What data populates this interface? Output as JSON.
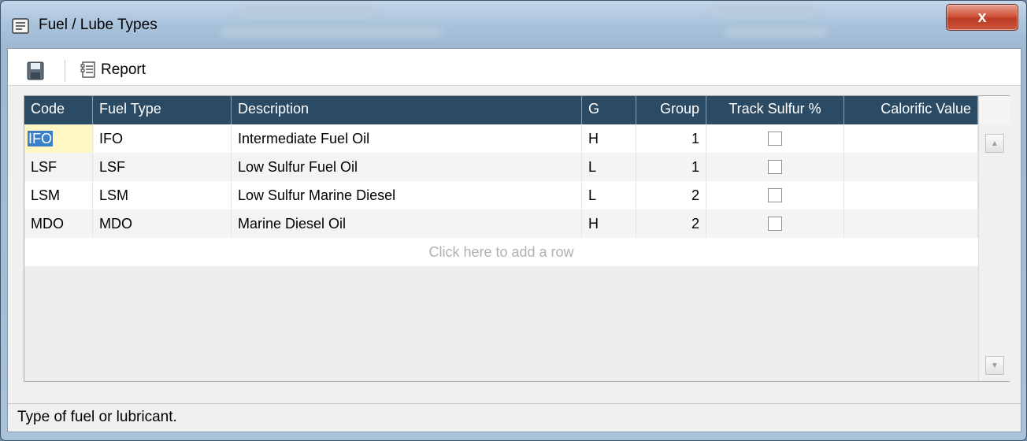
{
  "window": {
    "title": "Fuel / Lube Types",
    "close_label": "x"
  },
  "toolbar": {
    "report_label": "Report"
  },
  "grid": {
    "columns": [
      "Code",
      "Fuel Type",
      "Description",
      "G",
      "Group",
      "Track Sulfur %",
      "Calorific Value"
    ],
    "rows": [
      {
        "code": "IFO",
        "fuel_type": "IFO",
        "description": "Intermediate Fuel Oil",
        "g": "H",
        "group": "1",
        "track_sulfur": false,
        "calorific_value": ""
      },
      {
        "code": "LSF",
        "fuel_type": "LSF",
        "description": "Low Sulfur Fuel Oil",
        "g": "L",
        "group": "1",
        "track_sulfur": false,
        "calorific_value": ""
      },
      {
        "code": "LSM",
        "fuel_type": "LSM",
        "description": "Low Sulfur Marine Diesel",
        "g": "L",
        "group": "2",
        "track_sulfur": false,
        "calorific_value": ""
      },
      {
        "code": "MDO",
        "fuel_type": "MDO",
        "description": "Marine Diesel Oil",
        "g": "H",
        "group": "2",
        "track_sulfur": false,
        "calorific_value": ""
      }
    ],
    "add_row_text": "Click here to add a row"
  },
  "status": {
    "text": "Type of fuel or lubricant."
  },
  "colors": {
    "header_bg": "#2b4a63",
    "close_button": "#c9553b",
    "selection": "#3c7fc9",
    "edit_cell": "#fff8c4"
  },
  "icons": [
    "window-list-icon",
    "save-icon",
    "report-icon",
    "close-icon",
    "scroll-up-icon",
    "scroll-down-icon"
  ]
}
